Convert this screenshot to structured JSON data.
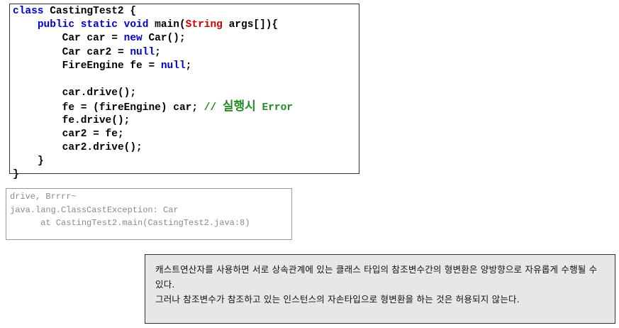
{
  "code": {
    "lines": [
      {
        "indent": "",
        "parts": [
          {
            "t": "kw",
            "v": "class"
          },
          {
            "t": "tx",
            "v": " CastingTest2 {"
          }
        ]
      },
      {
        "indent": "    ",
        "parts": [
          {
            "t": "kw",
            "v": "public static void"
          },
          {
            "t": "tx",
            "v": " main("
          },
          {
            "t": "ty",
            "v": "String"
          },
          {
            "t": "tx",
            "v": " args[]){"
          }
        ]
      },
      {
        "indent": "        ",
        "parts": [
          {
            "t": "tx",
            "v": "Car car = "
          },
          {
            "t": "kw",
            "v": "new"
          },
          {
            "t": "tx",
            "v": " Car();"
          }
        ]
      },
      {
        "indent": "        ",
        "parts": [
          {
            "t": "tx",
            "v": "Car car2 = "
          },
          {
            "t": "kw",
            "v": "null"
          },
          {
            "t": "tx",
            "v": ";"
          }
        ]
      },
      {
        "indent": "        ",
        "parts": [
          {
            "t": "tx",
            "v": "FireEngine fe = "
          },
          {
            "t": "kw",
            "v": "null"
          },
          {
            "t": "tx",
            "v": ";"
          }
        ]
      },
      {
        "indent": "",
        "parts": []
      },
      {
        "indent": "        ",
        "parts": [
          {
            "t": "tx",
            "v": "car.drive();"
          }
        ]
      },
      {
        "indent": "        ",
        "parts": [
          {
            "t": "tx",
            "v": "fe = (fireEngine) car; "
          },
          {
            "t": "cm",
            "v": "// "
          },
          {
            "t": "cmkr",
            "v": "실행시"
          },
          {
            "t": "cm",
            "v": " Error"
          }
        ]
      },
      {
        "indent": "        ",
        "parts": [
          {
            "t": "tx",
            "v": "fe.drive();"
          }
        ]
      },
      {
        "indent": "        ",
        "parts": [
          {
            "t": "tx",
            "v": "car2 = fe;"
          }
        ]
      },
      {
        "indent": "        ",
        "parts": [
          {
            "t": "tx",
            "v": "car2.drive();"
          }
        ]
      },
      {
        "indent": "    ",
        "parts": [
          {
            "t": "tx",
            "v": "}"
          }
        ]
      },
      {
        "indent": "",
        "parts": [
          {
            "t": "tx",
            "v": "}"
          }
        ]
      }
    ]
  },
  "output": {
    "lines": [
      "drive, Brrrr~",
      "java.lang.ClassCastException: Car",
      "      at CastingTest2.main(CastingTest2.java:8)"
    ]
  },
  "note": {
    "paragraph1": "캐스트연산자를 사용하면 서로 상속관계에 있는 클래스 타입의 참조변수간의 형변환은 양방향으로 자유롭게 수행될 수 있다.",
    "paragraph2": " 그러나 참조변수가 참조하고 있는 인스턴스의 자손타입으로 형변환을 하는 것은 허용되지 않는다."
  }
}
